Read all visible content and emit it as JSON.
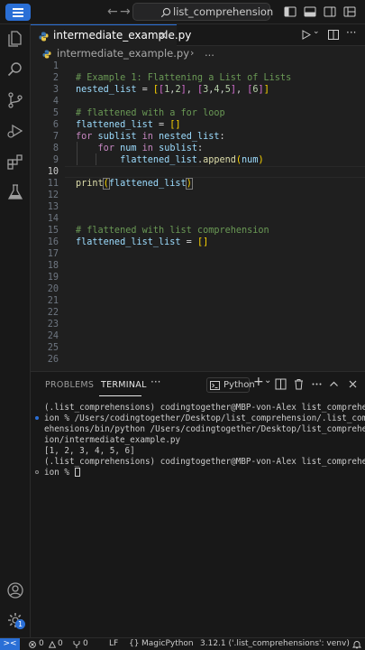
{
  "titlebar": {
    "nav_back": "←",
    "nav_forward": "→",
    "search_text": "list_comprehension"
  },
  "tabs": [
    {
      "label": "intermediate_example.py",
      "close": "×"
    }
  ],
  "editor_actions": {
    "run": "▷ ⌄",
    "split": "▯",
    "more": "···"
  },
  "breadcrumb": {
    "file": "intermediate_example.py",
    "separator": "›",
    "more": "..."
  },
  "editor": {
    "active_line": 10,
    "line_numbers": [
      "1",
      "2",
      "3",
      "4",
      "5",
      "6",
      "7",
      "8",
      "9",
      "10",
      "11",
      "12",
      "13",
      "14",
      "15",
      "16",
      "17",
      "18",
      "19",
      "20",
      "21",
      "22",
      "23",
      "24",
      "25",
      "26"
    ],
    "lines": [
      "# Example 1: Flattening a List of Lists",
      "nested_list = [[1,2], [3,4,5], [6]]",
      "",
      "# flattened with a for loop",
      "flattened_list = []",
      "for sublist in nested_list:",
      "    for num in sublist:",
      "        flattened_list.append(num)",
      "",
      "print(flattened_list)",
      "",
      "",
      "",
      "# flattened with list comprehension",
      "flattened_list_list = []"
    ]
  },
  "panel": {
    "tabs": [
      "PROBLEMS",
      "TERMINAL"
    ],
    "more": "···",
    "shell_label": "Python",
    "add": "+",
    "chevron": "⌄",
    "terminal_lines": [
      "(.list_comprehensions) codingtogether@MBP-von-Alex list_comprehens",
      "ion % /Users/codingtogether/Desktop/list_comprehension/.list_compr",
      "ehensions/bin/python /Users/codingtogether/Desktop/list_comprehens",
      "ion/intermediate_example.py",
      "[1, 2, 3, 4, 5, 6]",
      "(.list_comprehensions) codingtogether@MBP-von-Alex list_comprehens",
      "ion % "
    ]
  },
  "statusbar": {
    "remote": "><",
    "errors": "0",
    "warnings": "0",
    "ports": "0",
    "eol": "LF",
    "language_icon": "{}",
    "language": "MagicPython",
    "interpreter": "3.12.1 ('.list_comprehensions': venv)"
  },
  "accounts_badge": "1",
  "colors": {
    "accent": "#2a6fd6",
    "comment": "#6a9955",
    "keyword": "#c586c0",
    "variable": "#9cdcfe",
    "function": "#dcdcaa",
    "number": "#b5cea8"
  },
  "icons": {
    "activity": [
      "explorer-icon",
      "search-icon",
      "source-control-icon",
      "run-debug-icon",
      "extensions-icon",
      "testing-icon",
      "account-icon",
      "manage-gear-icon"
    ],
    "titlebar": [
      "menu-icon",
      "toggle-sidebar-icon",
      "toggle-panel-icon",
      "toggle-secondary-sidebar-icon",
      "layout-icon"
    ]
  }
}
